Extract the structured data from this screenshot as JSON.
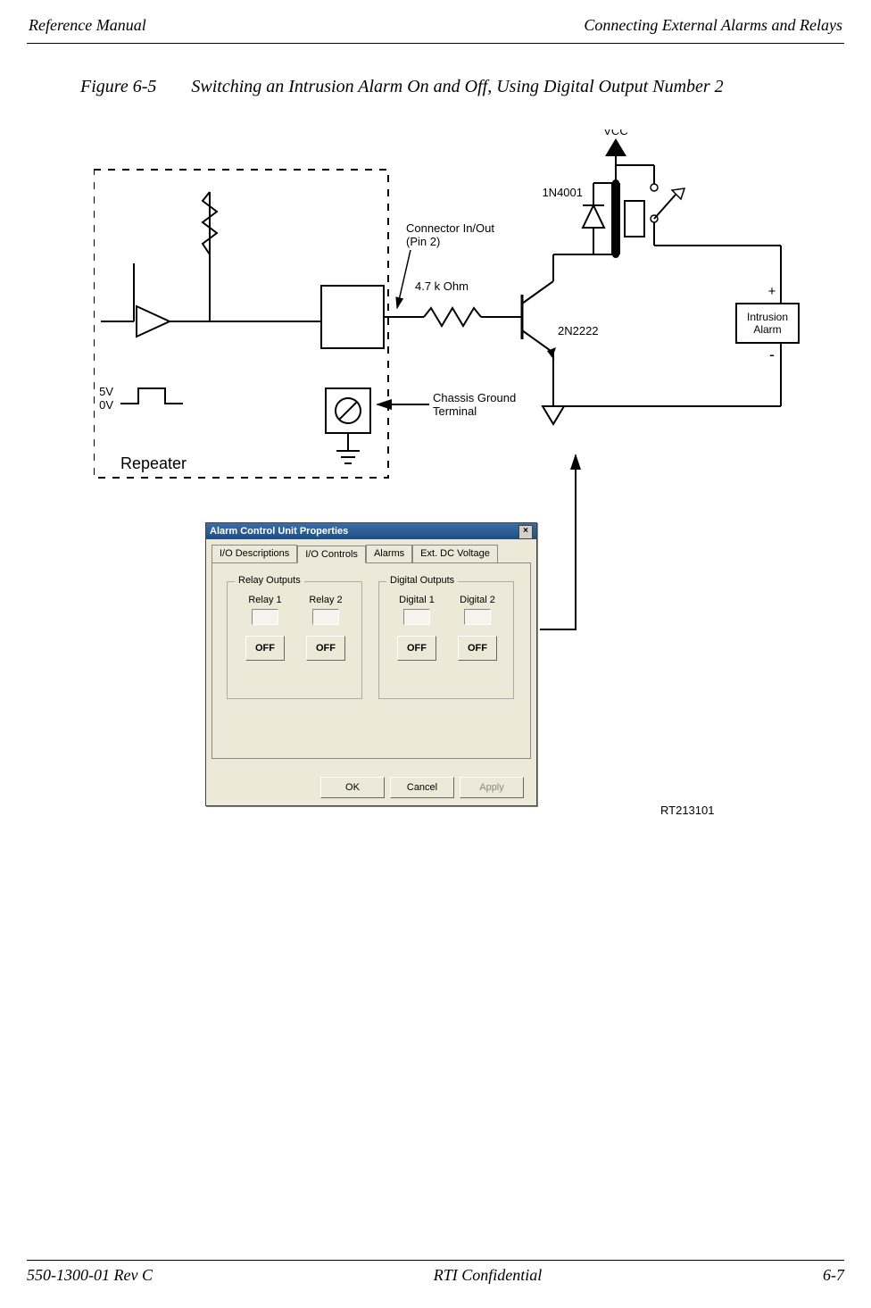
{
  "header": {
    "left": "Reference Manual",
    "right": "Connecting External Alarms and Relays"
  },
  "figure": {
    "number": "Figure 6-5",
    "caption": "Switching an Intrusion Alarm On and Off, Using Digital Output Number 2"
  },
  "schematic": {
    "vcc": "VCC",
    "diode": "1N4001",
    "resistor": "4.7 k Ohm",
    "transistor": "2N2222",
    "connector_line1": "Connector In/Out",
    "connector_line2": "(Pin 2)",
    "chassis_line1": "Chassis Ground",
    "chassis_line2": "Terminal",
    "alarm_line1": "Intrusion",
    "alarm_line2": "Alarm",
    "plus": "+",
    "minus": "-",
    "v5": "5V",
    "v0": "0V",
    "repeater": "Repeater"
  },
  "dialog": {
    "title": "Alarm Control Unit Properties",
    "tabs": {
      "t1": "I/O Descriptions",
      "t2": "I/O Controls",
      "t3": "Alarms",
      "t4": "Ext. DC Voltage"
    },
    "relay_group": "Relay Outputs",
    "digital_group": "Digital Outputs",
    "relay1": "Relay 1",
    "relay2": "Relay 2",
    "digital1": "Digital 1",
    "digital2": "Digital 2",
    "off": "OFF",
    "ok": "OK",
    "cancel": "Cancel",
    "apply": "Apply"
  },
  "figure_id": "RT213101",
  "footer": {
    "left": "550-1300-01 Rev C",
    "center": "RTI Confidential",
    "right": "6-7"
  }
}
